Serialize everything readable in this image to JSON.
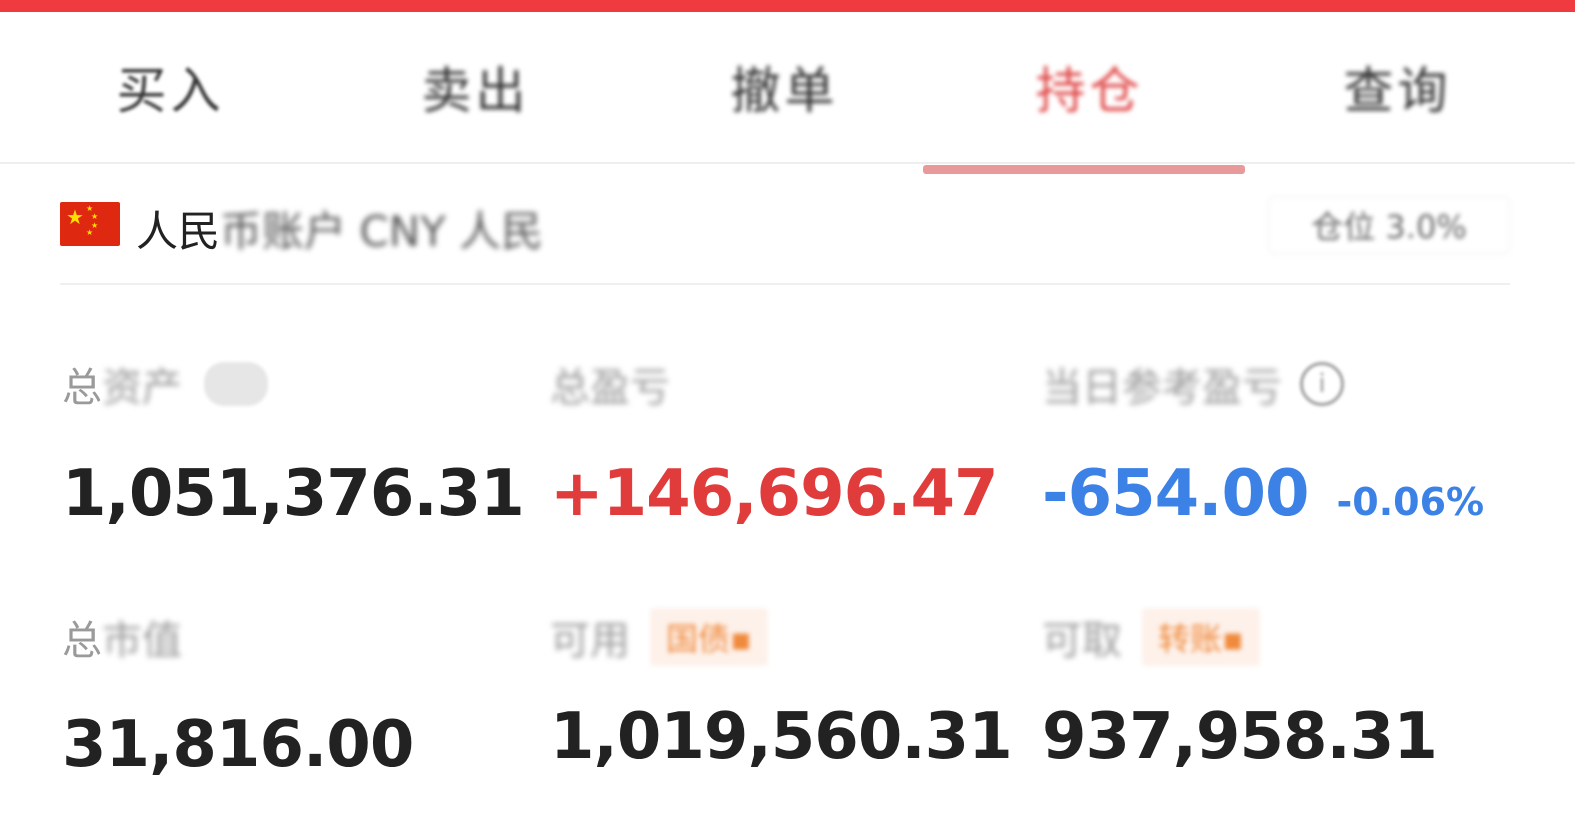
{
  "colors": {
    "brand_red": "#ef3b40",
    "indicator": "#e8999a",
    "negative_blue": "#3c82e6",
    "positive_red": "#e03c3c",
    "tag_orange": "#f08a3c"
  },
  "tabs": [
    {
      "label": "买入",
      "active": false
    },
    {
      "label": "卖出",
      "active": false
    },
    {
      "label": "撤单",
      "active": false
    },
    {
      "label": "持仓",
      "active": true
    },
    {
      "label": "查询",
      "active": false
    }
  ],
  "account": {
    "flag_icon": "china-flag-icon",
    "currency_visible": "人民",
    "currency_rest": "币账户 CNY 人民",
    "right_text": "仓位 3.0%"
  },
  "summary": {
    "total_assets": {
      "label_visible": "总",
      "label_rest": "资产",
      "value": "1,051,376.31"
    },
    "total_pnl": {
      "label": "总盈亏",
      "value": "+146,696.47"
    },
    "today_pnl": {
      "label": "当日参考盈亏",
      "value": "-654.00",
      "percent": "-0.06%"
    },
    "market_value": {
      "label_visible": "总",
      "label_rest": "市值",
      "value": "31,816.00"
    },
    "available": {
      "label": "可用",
      "tag": "国债▪",
      "value": "1,019,560.31"
    },
    "withdrawable": {
      "label": "可取",
      "tag": "转账▪",
      "value": "937,958.31"
    }
  }
}
